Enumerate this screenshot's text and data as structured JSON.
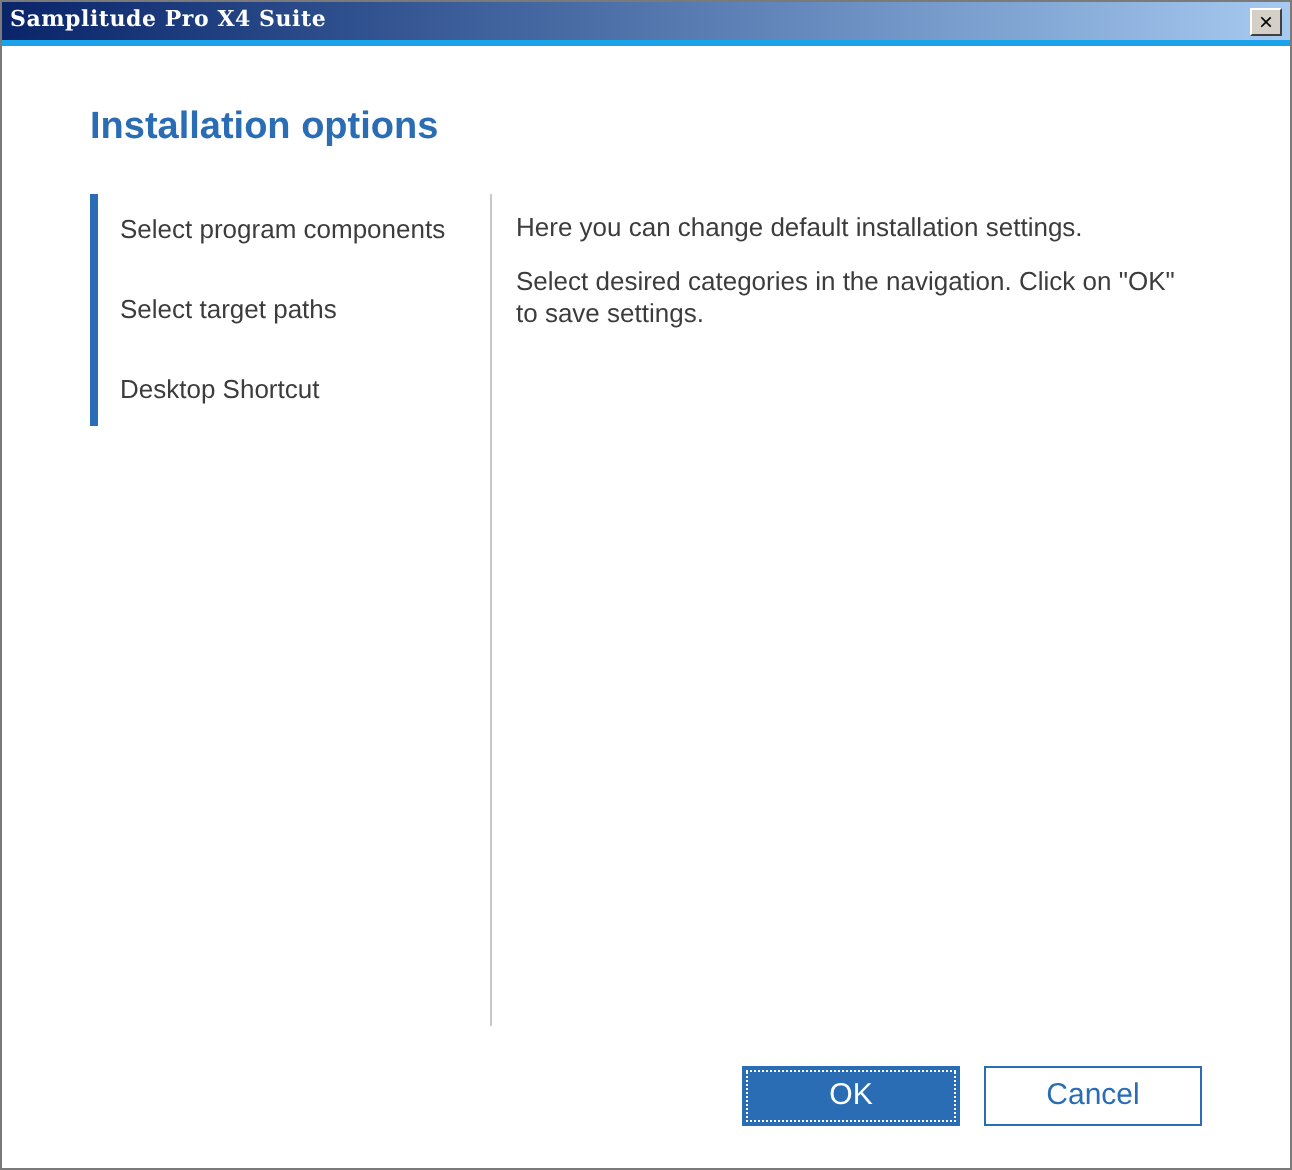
{
  "window": {
    "title": "Samplitude Pro X4 Suite",
    "close": "×"
  },
  "heading": "Installation options",
  "navigation": {
    "items": [
      {
        "label": "Select program components"
      },
      {
        "label": "Select target paths"
      },
      {
        "label": "Desktop Shortcut"
      }
    ]
  },
  "content": {
    "paragraphs": [
      "Here you can change default installation settings.",
      "Select desired categories in the navigation. Click on \"OK\" to save settings."
    ]
  },
  "buttons": [
    {
      "label": "OK",
      "kind": "primary"
    },
    {
      "label": "Cancel",
      "kind": "secondary"
    }
  ]
}
